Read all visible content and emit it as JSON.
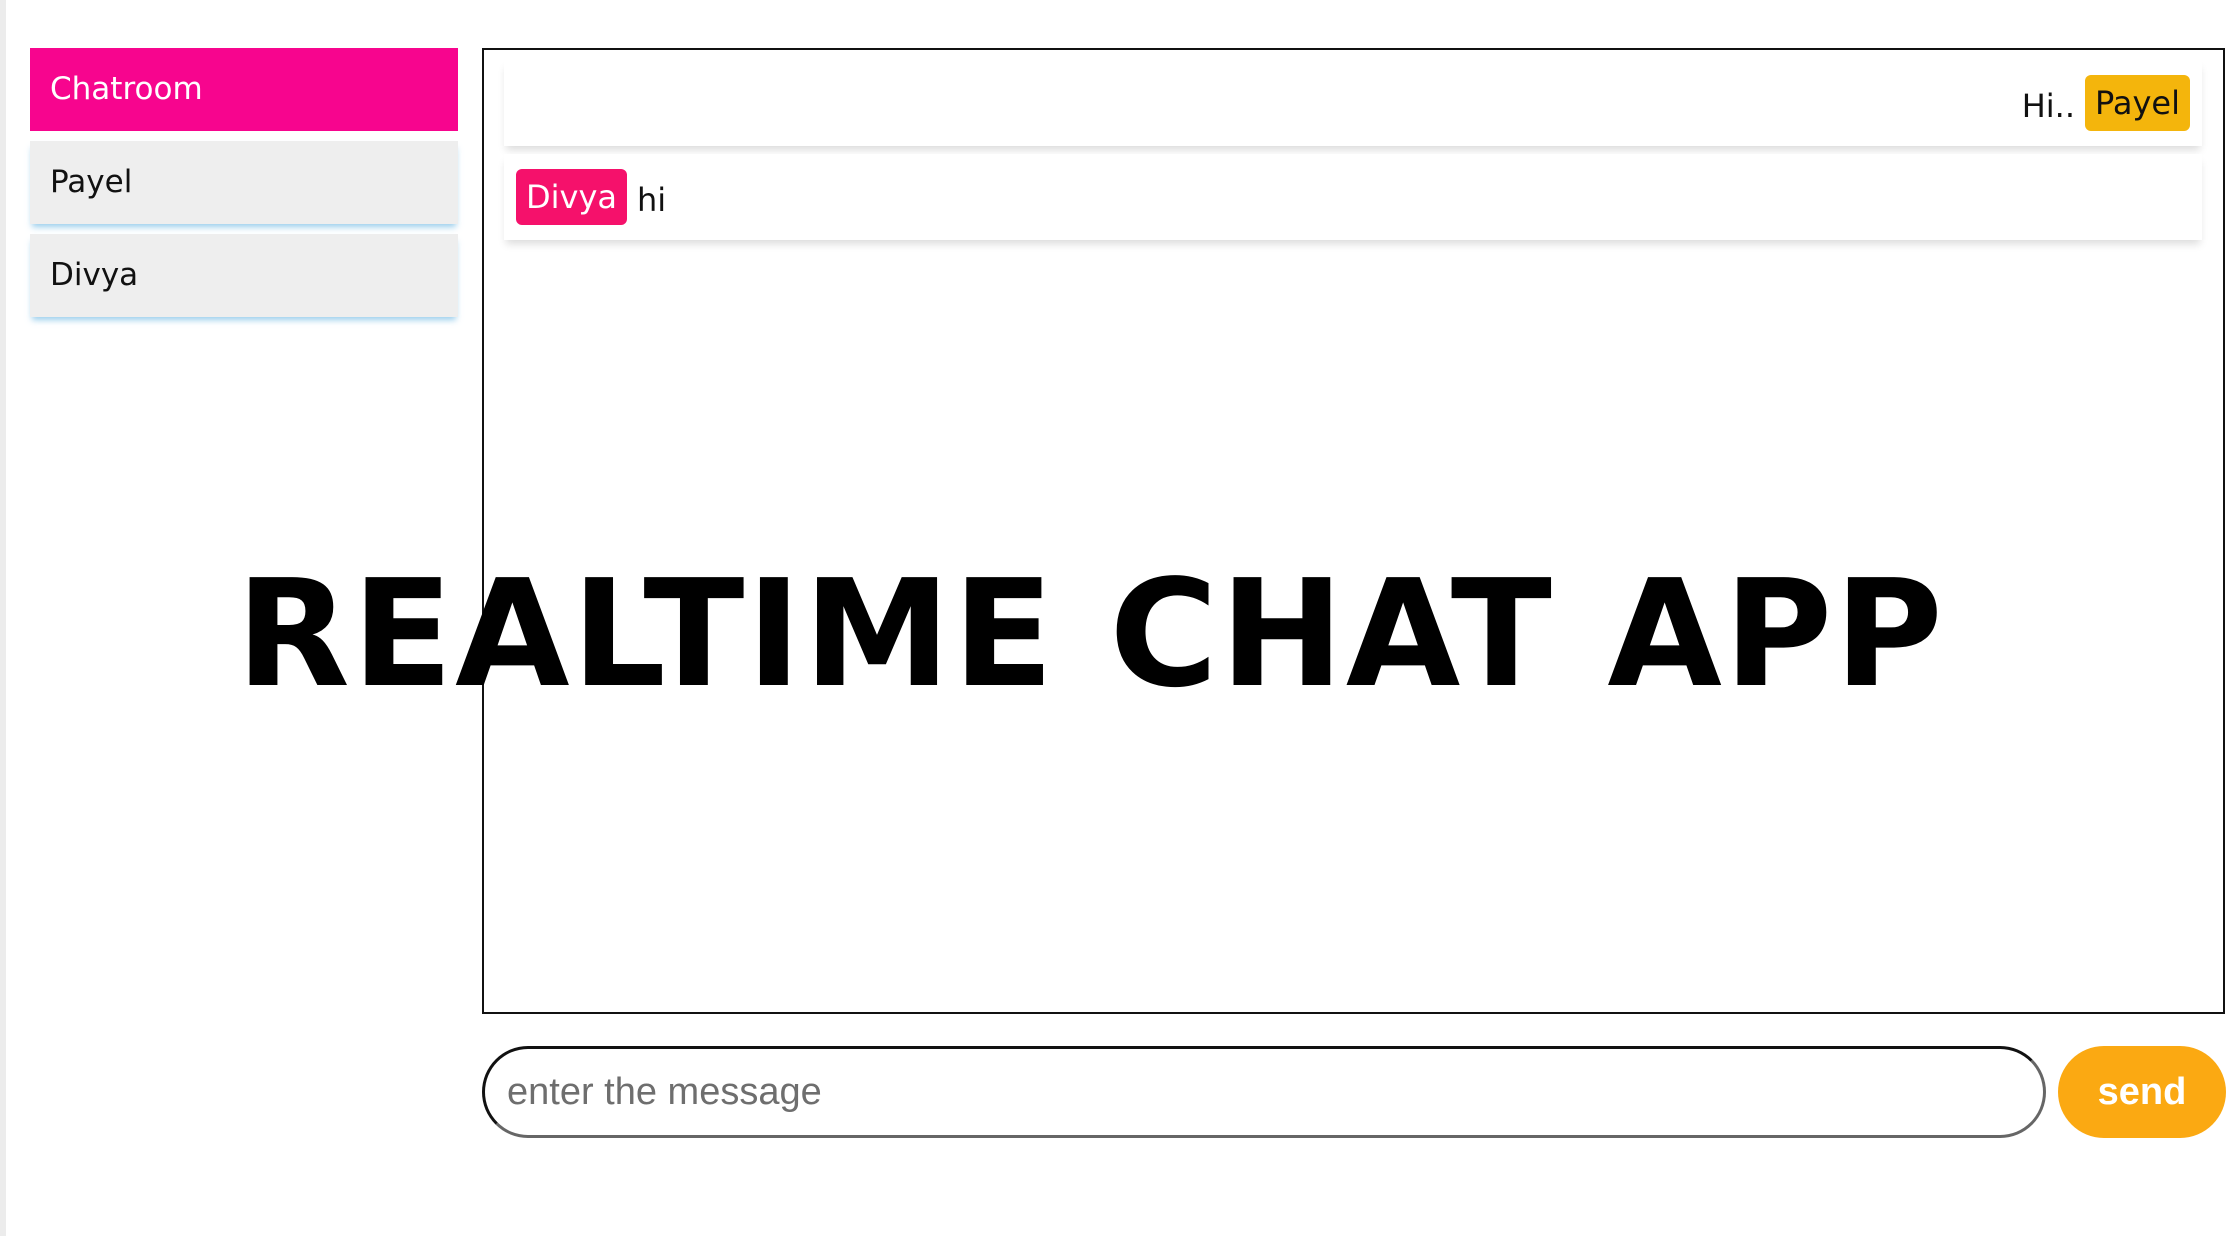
{
  "sidebar": {
    "items": [
      {
        "label": "Chatroom",
        "active": true
      },
      {
        "label": "Payel",
        "active": false
      },
      {
        "label": "Divya",
        "active": false
      }
    ]
  },
  "messages": [
    {
      "sender": "Payel",
      "text": "Hi..",
      "align": "right",
      "badge_color": "#f4b50c",
      "badge_text_color": "#111111"
    },
    {
      "sender": "Divya",
      "text": "hi",
      "align": "left",
      "badge_color": "#f5116b",
      "badge_text_color": "#ffffff"
    }
  ],
  "overlay": {
    "title": "REALTIME CHAT APP"
  },
  "composer": {
    "placeholder": "enter the message",
    "value": "",
    "send_label": "send"
  },
  "colors": {
    "accent_pink": "#f7058e",
    "send_orange": "#fba912"
  }
}
